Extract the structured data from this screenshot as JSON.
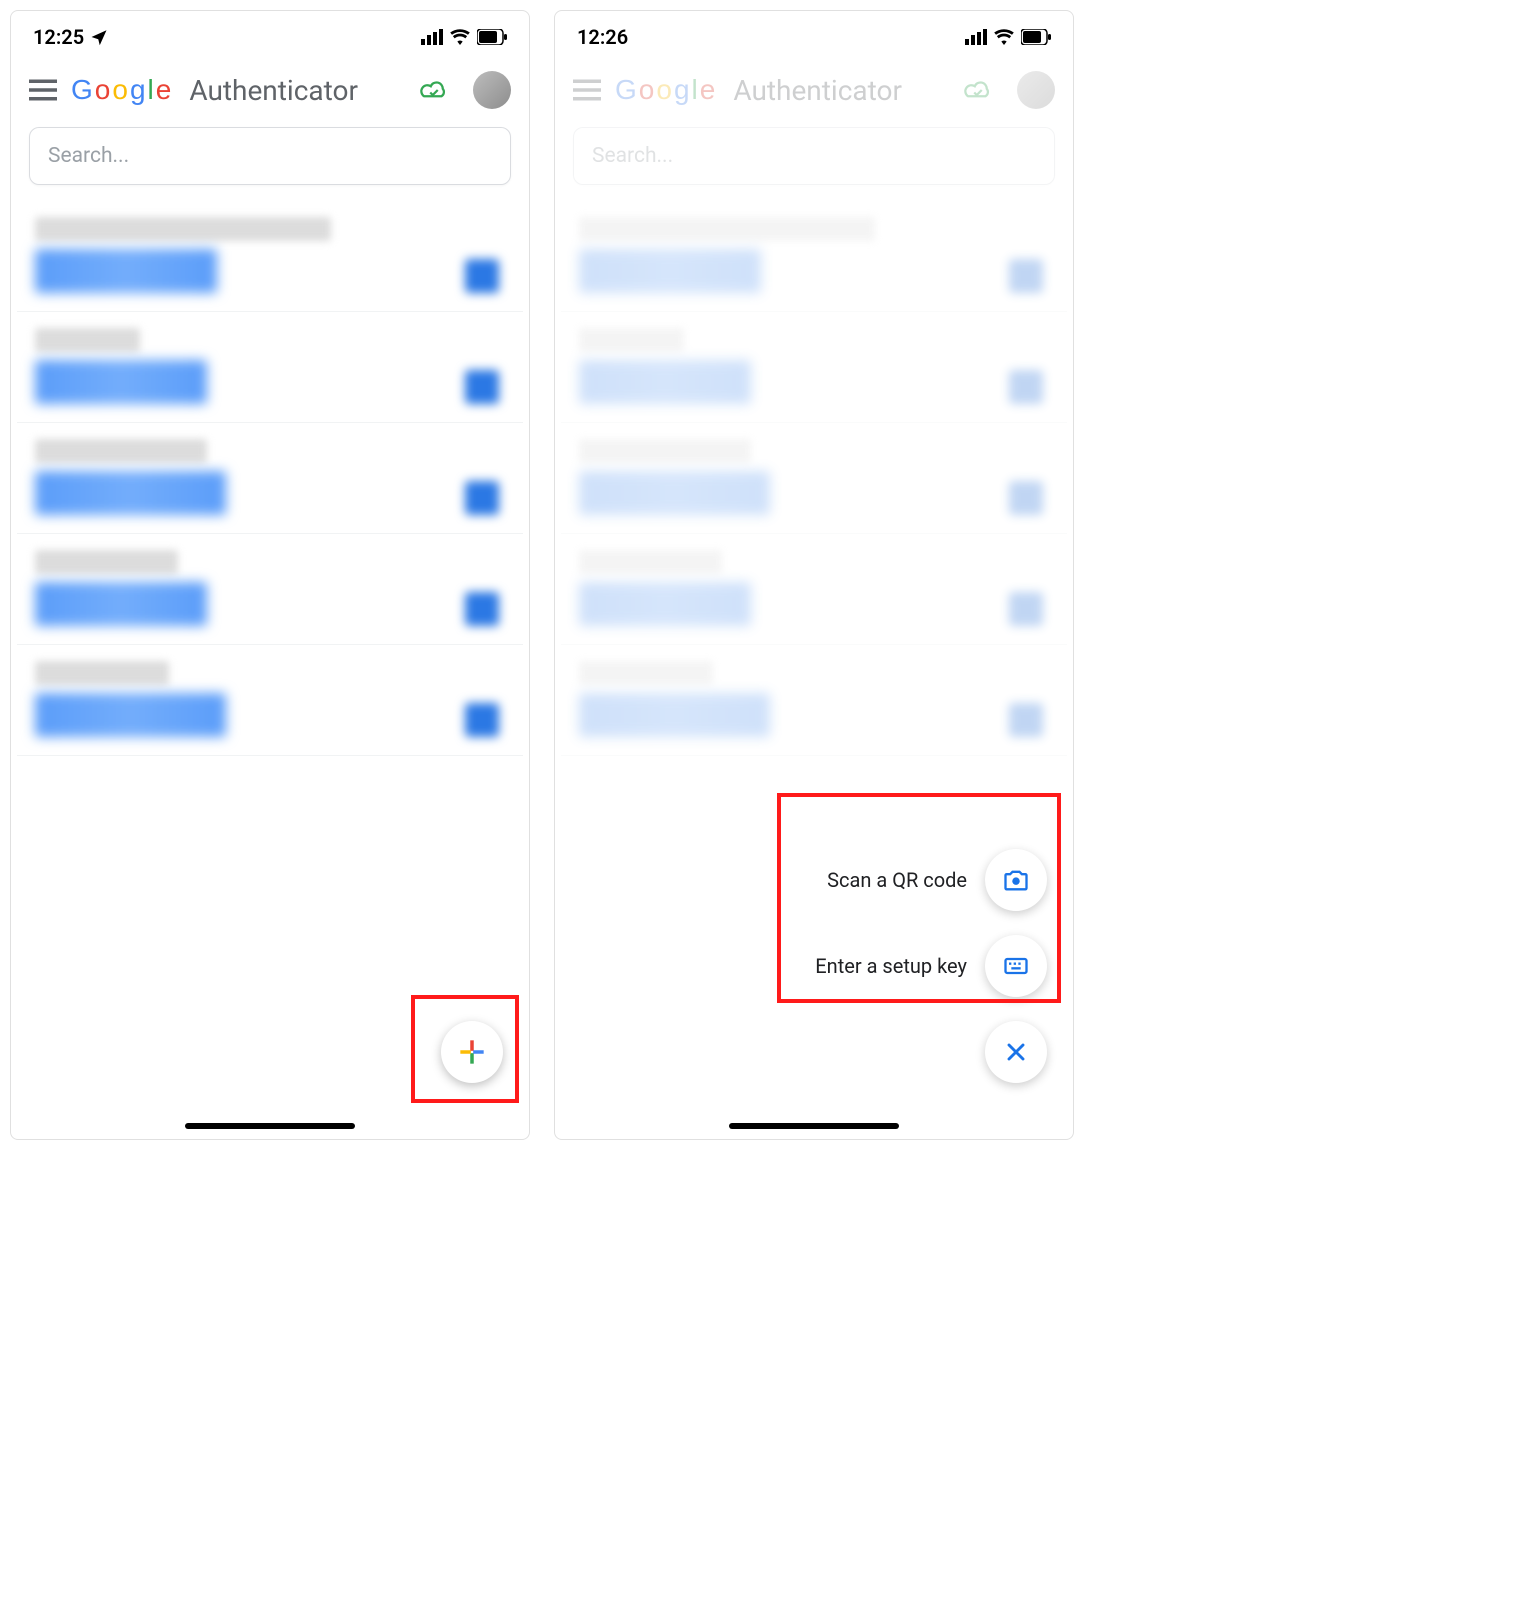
{
  "left": {
    "status": {
      "time": "12:25"
    },
    "app": {
      "brand": "Google",
      "title": "Authenticator"
    },
    "search": {
      "placeholder": "Search..."
    }
  },
  "right": {
    "status": {
      "time": "12:26"
    },
    "app": {
      "brand": "Google",
      "title": "Authenticator"
    },
    "search": {
      "placeholder": "Search..."
    },
    "actions": {
      "scan": "Scan a QR code",
      "setup": "Enter a setup key"
    }
  }
}
